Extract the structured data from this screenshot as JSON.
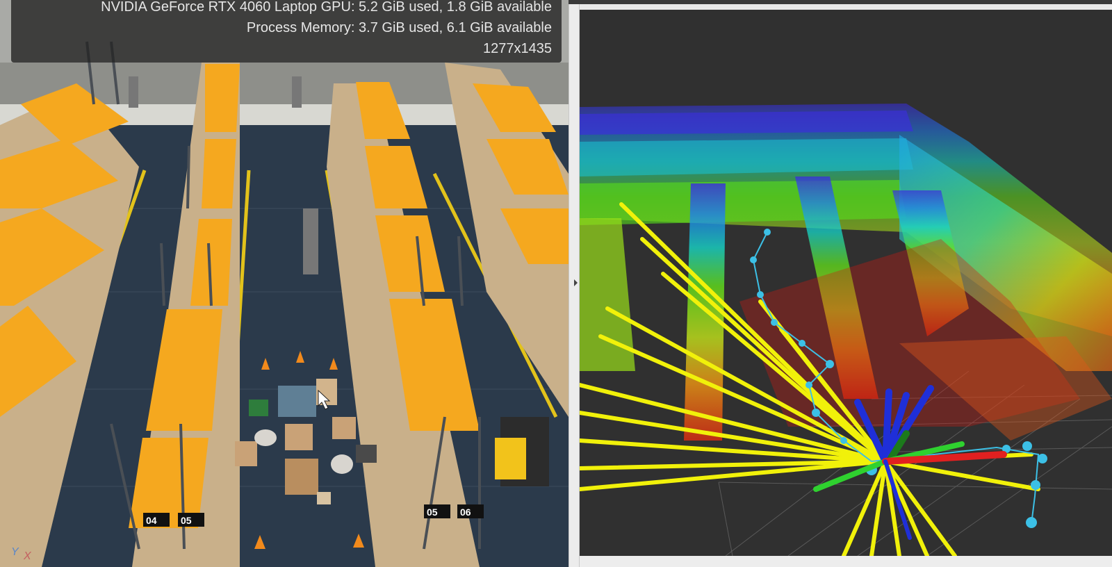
{
  "sim_viewport": {
    "stats": {
      "gpu_line": "NVIDIA GeForce RTX 4060 Laptop GPU: 5.2 GiB used, 1.8 GiB available",
      "memory_line": "Process Memory: 3.7 GiB used, 6.1 GiB available",
      "resolution_line": "1277x1435"
    },
    "shelf_labels": [
      "04",
      "05",
      "05",
      "06"
    ],
    "axis_gizmo": {
      "y": "Y",
      "x": "X"
    }
  },
  "rviz_view": {
    "colors": {
      "background": "#303030",
      "laser_rays": "#f1f10a",
      "trajectory": "#3cc0e6",
      "axis_z": "#1f2fd8",
      "axis_y": "#2fd12f",
      "axis_x": "#e12020"
    },
    "icons": [
      "robot-tf-frame-icon",
      "trajectory-path-icon",
      "point-cloud-icon"
    ]
  },
  "colors": {
    "floor": "#2b3a4b",
    "shelf_orange": "#f5a81f",
    "floor_line": "#e2c21b"
  }
}
